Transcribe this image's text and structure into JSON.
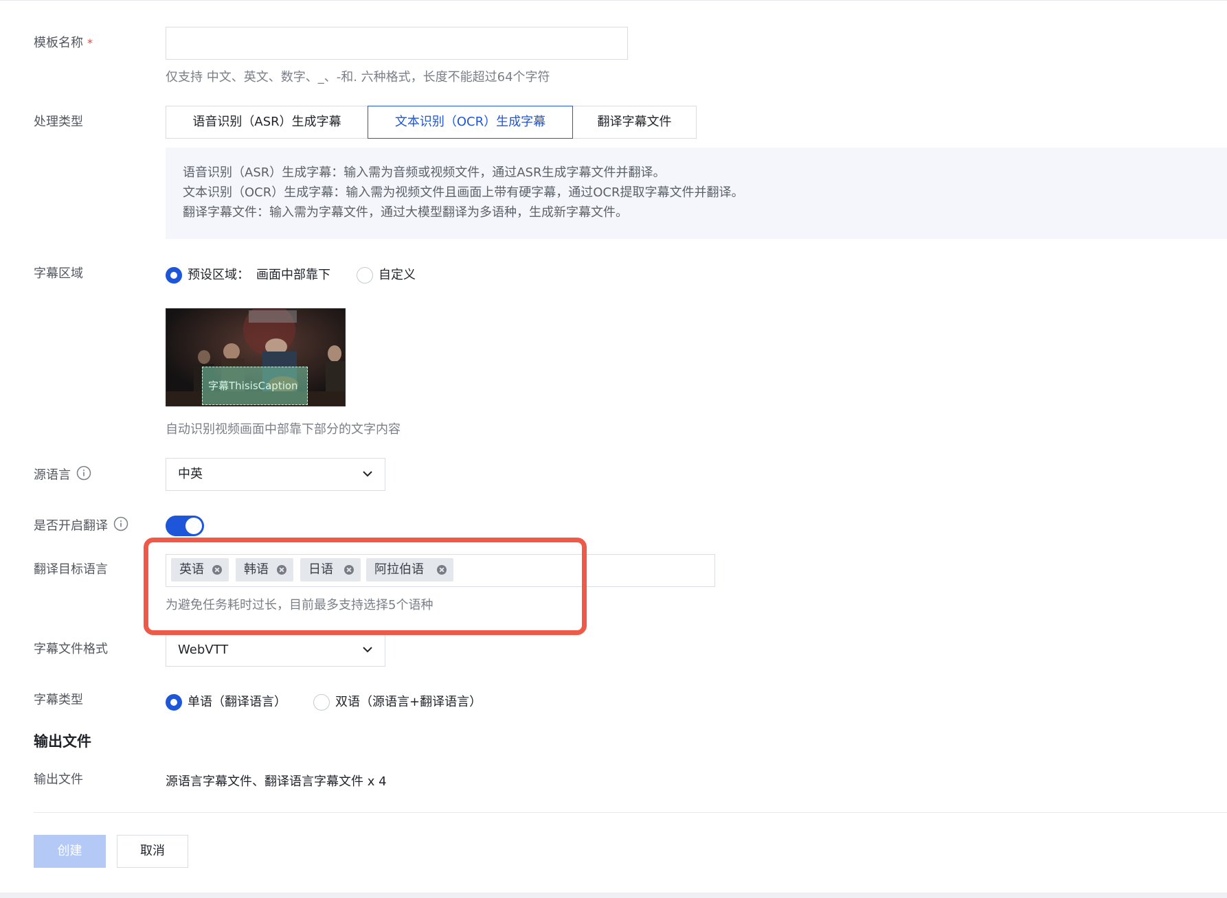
{
  "form": {
    "template_name": {
      "label": "模板名称",
      "required_mark": "*",
      "value": "",
      "hint": "仅支持 中文、英文、数字、_、-和. 六种格式，长度不能超过64个字符"
    },
    "process_type": {
      "label": "处理类型",
      "options": [
        "语音识别（ASR）生成字幕",
        "文本识别（OCR）生成字幕",
        "翻译字幕文件"
      ],
      "selected": "文本识别（OCR）生成字幕",
      "descriptions": [
        "语音识别（ASR）生成字幕：输入需为音频或视频文件，通过ASR生成字幕文件并翻译。",
        "文本识别（OCR）生成字幕：输入需为视频文件且画面上带有硬字幕，通过OCR提取字幕文件并翻译。",
        "翻译字幕文件：输入需为字幕文件，通过大模型翻译为多语种，生成新字幕文件。"
      ]
    },
    "subtitle_region": {
      "label": "字幕区域",
      "preset_label": "预设区域：",
      "preset_value": "画面中部靠下",
      "custom_label": "自定义",
      "selected": "preset",
      "preview_caption": "字幕ThisisCaption",
      "hint": "自动识别视频画面中部靠下部分的文字内容"
    },
    "source_language": {
      "label": "源语言",
      "value": "中英"
    },
    "enable_translation": {
      "label": "是否开启翻译",
      "on": true
    },
    "target_languages": {
      "label": "翻译目标语言",
      "tags": [
        "英语",
        "韩语",
        "日语",
        "阿拉伯语"
      ],
      "hint": "为避免任务耗时过长，目前最多支持选择5个语种"
    },
    "subtitle_format": {
      "label": "字幕文件格式",
      "value": "WebVTT"
    },
    "subtitle_type": {
      "label": "字幕类型",
      "options": [
        "单语（翻译语言）",
        "双语（源语言+翻译语言）"
      ],
      "selected": "单语（翻译语言）"
    }
  },
  "output": {
    "section_title": "输出文件",
    "label": "输出文件",
    "value": "源语言字幕文件、翻译语言字幕文件 x 4"
  },
  "actions": {
    "create_label": "创建",
    "cancel_label": "取消"
  },
  "colors": {
    "primary": "#1d56d8",
    "highlight": "#ee5a47",
    "create_disabled": "#b5c9f7"
  }
}
